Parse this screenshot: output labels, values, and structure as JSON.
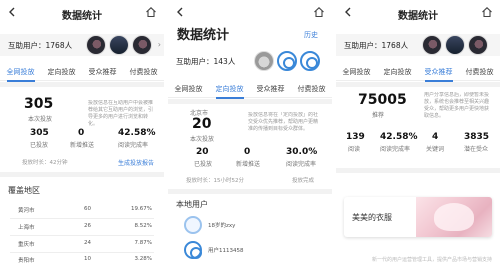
{
  "screen1": {
    "title": "数据统计",
    "user_count_label": "互助用户：1768人",
    "tabs": [
      "全网投放",
      "定向投放",
      "受众推荐",
      "付费投放"
    ],
    "metric_main": {
      "value": "305",
      "label": "本次投放"
    },
    "metric_desc": "投放信息在互助用户中会被推荐给其它互助用户的浏览，引导更多的用户进行浏览和转化。",
    "stats": [
      {
        "value": "305",
        "label": "已投放"
      },
      {
        "value": "0",
        "label": "新增推送"
      },
      {
        "value": "42.58%",
        "label": "阅读完成率"
      }
    ],
    "duration": "投放时长：42分钟",
    "report_link": "生成投放报告",
    "coverage_title": "覆盖地区",
    "coverage_rows": [
      {
        "city": "黄河市",
        "count": "60",
        "pct": "19.67%"
      },
      {
        "city": "上海市",
        "count": "26",
        "pct": "8.52%"
      },
      {
        "city": "重庆市",
        "count": "24",
        "pct": "7.87%"
      },
      {
        "city": "贵阳市",
        "count": "10",
        "pct": "3.28%"
      }
    ]
  },
  "screen2": {
    "title": "数据统计",
    "history": "历史",
    "user_count_label": "互助用户：143人",
    "tabs": [
      "全网投放",
      "定向投放",
      "受众推荐",
      "付费投放"
    ],
    "region": "北京市",
    "metric_main": {
      "value": "20",
      "label": "本次投放"
    },
    "metric_desc": "投放信息将在「定向投放」的社交受众优先推荐，帮助用户更精准的传播到目标受众群体。",
    "stats": [
      {
        "value": "20",
        "label": "已投放"
      },
      {
        "value": "0",
        "label": "新增推送"
      },
      {
        "value": "30.0%",
        "label": "阅读完成率"
      }
    ],
    "duration": "投放时长：15小时52分",
    "done": "投放完成",
    "local_users_title": "本地用户",
    "users": [
      {
        "name": "18岁的zxy"
      },
      {
        "name": "用户1113458"
      }
    ]
  },
  "screen3": {
    "title": "数据统计",
    "user_count_label": "互助用户：1768人",
    "tabs": [
      "全网投放",
      "定向投放",
      "受众推荐",
      "付费投放"
    ],
    "metric_main": {
      "value": "75005",
      "label": "推荐"
    },
    "metric_desc": "用户分享信息后，即使暂未投放，系统也会推荐至相关兴趣受众，帮助更多用户更快地获取信息。",
    "stats": [
      {
        "value": "139",
        "label": "阅读"
      },
      {
        "value": "42.58%",
        "label": "阅读完成率"
      },
      {
        "value": "4",
        "label": "关键词"
      },
      {
        "value": "3835",
        "label": "潜在受众"
      }
    ],
    "card_text": "美美的衣服",
    "footer": "新一代的用户运营管理工具，提供产品市场与营销支持"
  }
}
